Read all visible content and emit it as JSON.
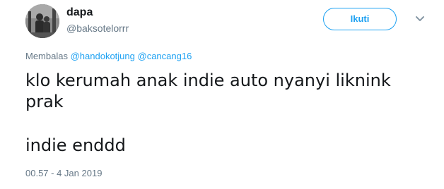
{
  "tweet": {
    "author": {
      "display_name": "dapa",
      "handle": "@baksotelorrr"
    },
    "follow_label": "Ikuti",
    "reply": {
      "prefix": "Membalas",
      "mentions": [
        "@handokotjung",
        "@cancang16"
      ]
    },
    "text": {
      "line1": "klo kerumah anak indie auto nyanyi liknink prak",
      "line2": "indie enddd"
    },
    "timestamp": "00.57 - 4 Jan 2019"
  },
  "colors": {
    "accent": "#1da1f2",
    "text": "#14171a",
    "muted": "#657786"
  },
  "icons": {
    "avatar": "profile-photo",
    "menu": "chevron-down-icon"
  }
}
